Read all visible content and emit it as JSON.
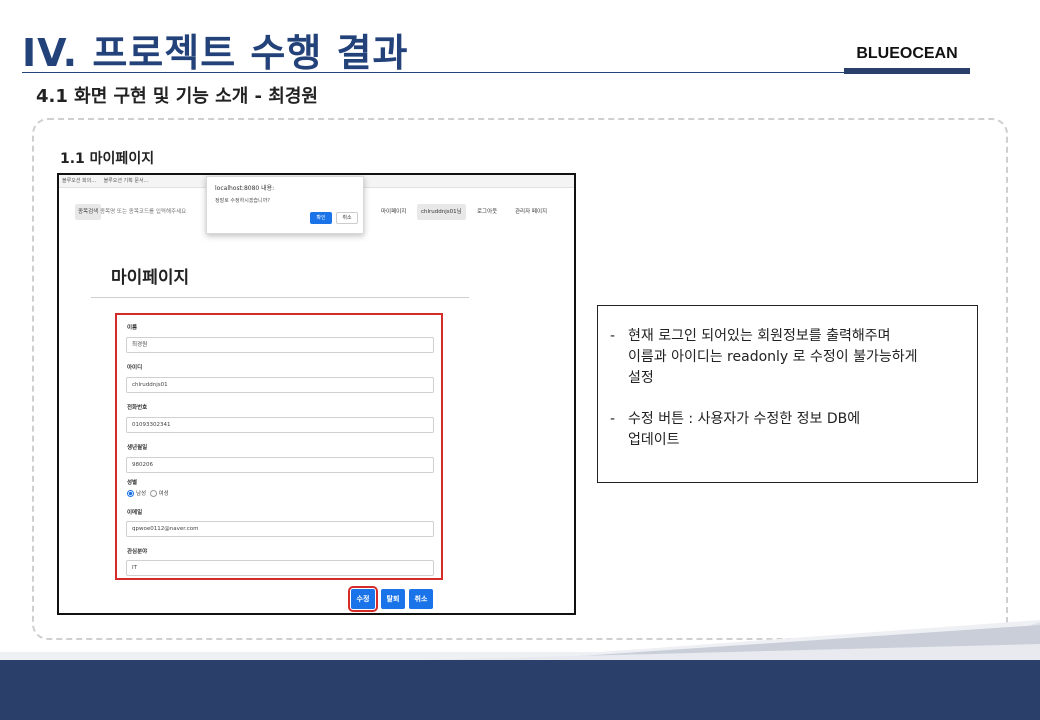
{
  "slide": {
    "title": "IV. 프로젝트 수행 결과",
    "brand": "BLUEOCEAN",
    "subtitle": "4.1 화면 구현 및 기능 소개 - 최경원",
    "section_label": "1.1 마이페이지"
  },
  "screenshot": {
    "browser_tabs": [
      "블루오션 회의...",
      "블루오션 기획 문서..."
    ],
    "search_chip": "종목검색",
    "search_placeholder": "종목명 또는 종목코드를 입력해주세요",
    "nav": [
      "마이페이지",
      "chlruddnjs01님",
      "로그아웃",
      "관리자 페이지"
    ],
    "dialog": {
      "title": "localhost:8080 내용:",
      "message": "정말로 수정하시겠습니까?",
      "ok": "확인",
      "cancel": "취소"
    },
    "page_title": "마이페이지",
    "fields": [
      {
        "label": "이름",
        "value": "최경원"
      },
      {
        "label": "아이디",
        "value": "chlruddnjs01"
      },
      {
        "label": "전화번호",
        "value": "01093302341"
      },
      {
        "label": "생년월일",
        "value": "980206"
      }
    ],
    "gender": {
      "label": "성별",
      "options": [
        "남성",
        "여성"
      ],
      "selected": "남성"
    },
    "fields2": [
      {
        "label": "이메일",
        "value": "qpwoe0112@naver.com"
      },
      {
        "label": "관심분야",
        "value": "IT"
      }
    ],
    "buttons": {
      "edit": "수정",
      "withdraw": "탈퇴",
      "cancel": "취소"
    }
  },
  "description": {
    "item1_line1": "현재 로그인 되어있는 회원정보를 출력해주며",
    "item1_line2": "이름과 아이디는 readonly 로 수정이 불가능하게",
    "item1_line3": "설정",
    "item2_line1": "수정 버튼 : 사용자가 수정한 정보 DB에",
    "item2_line2": "업데이트",
    "dash": "-"
  },
  "colors": {
    "title": "#24427a",
    "footer_dark": "#2b3f6b",
    "highlight": "#d62b2b",
    "button": "#1a73e8"
  }
}
